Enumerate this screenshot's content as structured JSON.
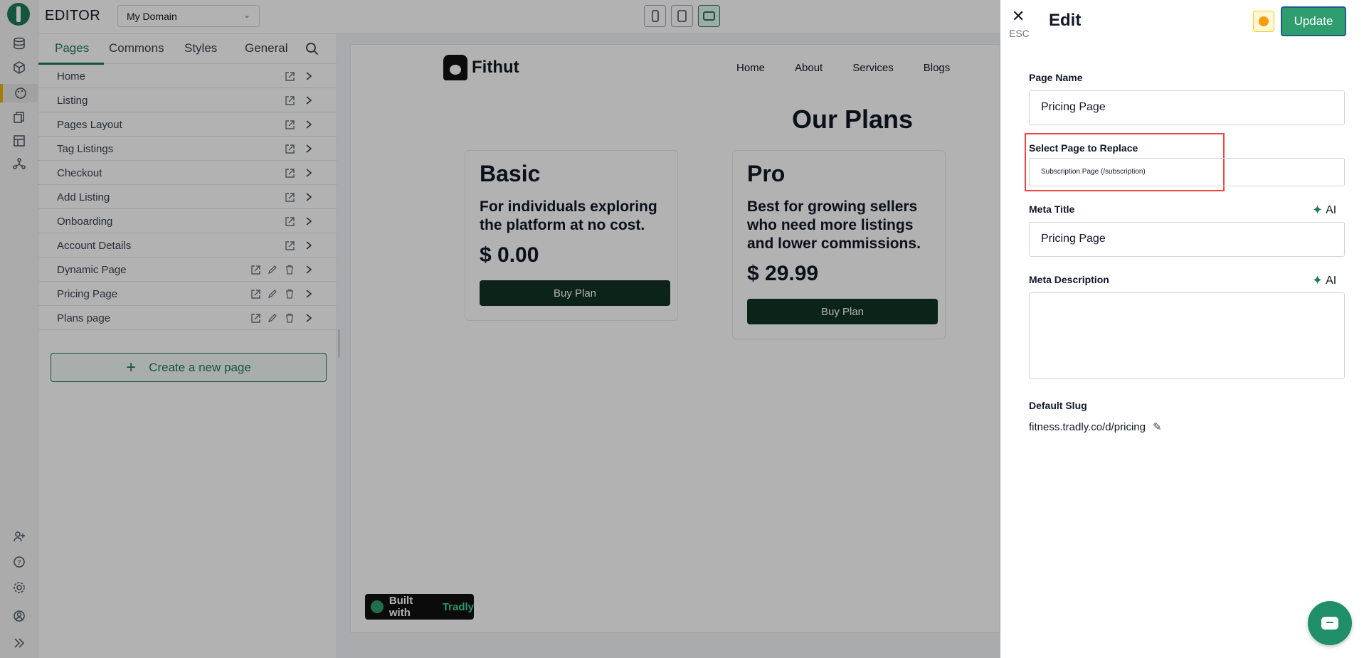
{
  "editor": {
    "title": "EDITOR",
    "domain": "My Domain"
  },
  "rail": {
    "icons": [
      "database-icon",
      "cube-icon",
      "palette-icon",
      "copy-icon",
      "layout-icon",
      "network-icon",
      "add-user-icon",
      "help-icon",
      "settings-icon",
      "account-icon",
      "expand-icon"
    ]
  },
  "devices": [
    "mobile-icon",
    "tablet-icon",
    "desktop-icon"
  ],
  "panel": {
    "tabs": [
      "Pages",
      "Commons",
      "Styles",
      "General"
    ],
    "pages": [
      {
        "label": "Home",
        "actions": [
          "edit"
        ]
      },
      {
        "label": "Listing",
        "actions": [
          "edit"
        ]
      },
      {
        "label": "Pages Layout",
        "actions": [
          "edit"
        ]
      },
      {
        "label": "Tag Listings",
        "actions": [
          "edit"
        ]
      },
      {
        "label": "Checkout",
        "actions": [
          "edit"
        ]
      },
      {
        "label": "Add Listing",
        "actions": [
          "edit"
        ]
      },
      {
        "label": "Onboarding",
        "actions": [
          "edit"
        ]
      },
      {
        "label": "Account Details",
        "actions": [
          "edit"
        ]
      },
      {
        "label": "Dynamic Page",
        "actions": [
          "edit",
          "rename",
          "delete"
        ]
      },
      {
        "label": "Pricing Page",
        "actions": [
          "edit",
          "rename",
          "delete"
        ]
      },
      {
        "label": "Plans page",
        "actions": [
          "edit",
          "rename",
          "delete"
        ]
      }
    ],
    "create_label": "Create a new page"
  },
  "preview": {
    "brand": "Fithut",
    "nav": [
      "Home",
      "About",
      "Services",
      "Blogs"
    ],
    "heading": "Our Plans",
    "plans": [
      {
        "name": "Basic",
        "description": "For individuals exploring the platform at no cost.",
        "price": "$ 0.00",
        "button": "Buy Plan"
      },
      {
        "name": "Pro",
        "description": "Best for growing sellers who need more listings and lower commissions.",
        "price": "$ 29.99",
        "button": "Buy Plan"
      }
    ],
    "built_with": "Built with",
    "built_brand": "Tradly"
  },
  "drawer": {
    "esc": "ESC",
    "title": "Edit",
    "update": "Update",
    "page_name_label": "Page Name",
    "page_name_value": "Pricing Page",
    "replace_label": "Select Page to Replace",
    "replace_value": "Subscription Page (/subscription)",
    "meta_title_label": "Meta Title",
    "meta_title_value": "Pricing Page",
    "meta_desc_label": "Meta Description",
    "meta_desc_value": "",
    "ai_label": "AI",
    "slug_label": "Default Slug",
    "slug_value": "fitness.tradly.co/d/pricing"
  },
  "colors": {
    "accent": "#1f7a5a",
    "update_button": "#2f9e6e",
    "highlight": "#ef4444",
    "rail_active": "#eab308"
  }
}
